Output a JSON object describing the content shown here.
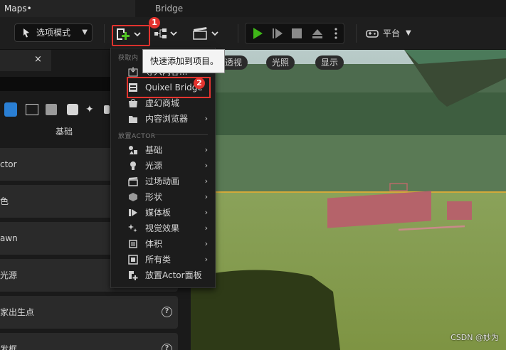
{
  "window": {
    "tab_title": "Maps•",
    "title": "Bridge"
  },
  "toolbar": {
    "mode_label": "选项模式",
    "platform_label": "平台",
    "quick_add_badge": "1"
  },
  "tooltip": {
    "text": "快速添加到项目。"
  },
  "menu": {
    "section_get_content": "获取内",
    "get_content_items": [
      {
        "label": "导入内容...",
        "icon": "import-icon"
      },
      {
        "label": "Quixel Bridge",
        "icon": "bridge-icon",
        "badge": "2"
      },
      {
        "label": "虚幻商城",
        "icon": "marketplace-icon"
      },
      {
        "label": "内容浏览器",
        "icon": "folder-icon",
        "has_submenu": true
      }
    ],
    "section_place_actor": "放置ACTOR",
    "place_actor_items": [
      {
        "label": "基础",
        "icon": "basic-icon",
        "has_submenu": true
      },
      {
        "label": "光源",
        "icon": "light-icon",
        "has_submenu": true
      },
      {
        "label": "过场动画",
        "icon": "cinematic-icon",
        "has_submenu": true
      },
      {
        "label": "形状",
        "icon": "shape-icon",
        "has_submenu": true
      },
      {
        "label": "媒体板",
        "icon": "media-icon",
        "has_submenu": true
      },
      {
        "label": "视觉效果",
        "icon": "vfx-icon",
        "has_submenu": true
      },
      {
        "label": "体积",
        "icon": "volume-icon",
        "has_submenu": true
      },
      {
        "label": "所有类",
        "icon": "all-classes-icon",
        "has_submenu": true
      },
      {
        "label": "放置Actor面板",
        "icon": "place-actor-icon",
        "has_submenu": false
      }
    ],
    "arrow": "›"
  },
  "left_panel": {
    "close": "×",
    "category_label": "基础",
    "items": [
      {
        "label": "ctor"
      },
      {
        "label": "色"
      },
      {
        "label": "awn"
      },
      {
        "label": "光源"
      },
      {
        "label": "家出生点",
        "help": true
      },
      {
        "label": "发框",
        "help": true
      }
    ],
    "help_glyph": "?"
  },
  "viewport": {
    "pill_perspective": "透视",
    "pill_lit": "光照",
    "pill_show": "显示",
    "watermark": "CSDN @妙为"
  },
  "colors": {
    "accent_red": "#e3342f",
    "play_green": "#3fb618"
  }
}
